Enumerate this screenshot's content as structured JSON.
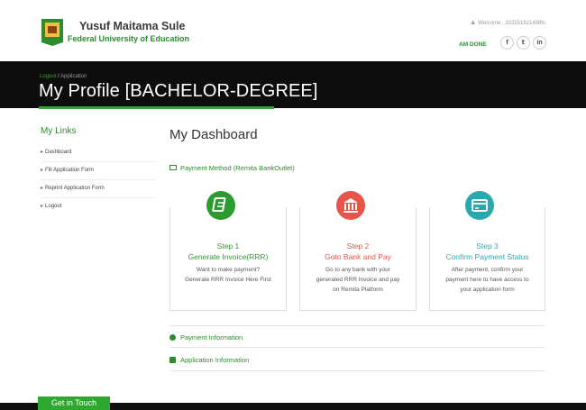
{
  "brand": {
    "name": "Yusuf Maitama Sule",
    "subtitle": "Federal University of Education"
  },
  "header": {
    "welcome": "Welcome , 20255192149​8fs",
    "am_done": "AM DONE",
    "social": [
      "f",
      "t",
      "in"
    ]
  },
  "banner": {
    "crumb_logout": "Logout",
    "crumb_sep": "/",
    "crumb_application": "Application",
    "title": "My Profile [BACHELOR-DEGREE]"
  },
  "sidebar": {
    "title": "My Links",
    "items": [
      {
        "label": "Dashboard"
      },
      {
        "label": "Fill Application Form"
      },
      {
        "label": "Reprint Application Form"
      },
      {
        "label": "Logout"
      }
    ]
  },
  "main": {
    "title": "My Dashboard",
    "payment_method": "Payment Method (Remita BankOutlet)",
    "steps": [
      {
        "step": "Step 1",
        "heading": "Generate Invoice(RRR)",
        "desc": "Want to make payment? Generate RRR Invoice Here First",
        "color": "#2e9b2e",
        "icon": "invoice-icon"
      },
      {
        "step": "Step 2",
        "heading": "Goto Bank and Pay",
        "desc": "Go to any bank with your generated RRR Invoice and pay on Remita Platform",
        "color": "#e8534a",
        "icon": "bank-icon"
      },
      {
        "step": "Step 3",
        "heading": "Confirm Payment Status",
        "desc": "After payment, confirm your payment here to have access to your application form",
        "color": "#2aa8b0",
        "icon": "card-icon"
      }
    ],
    "payment_information": "Payment Information",
    "application_information": "Application Information"
  },
  "footer": {
    "get_in_touch": "Get in Touch"
  }
}
